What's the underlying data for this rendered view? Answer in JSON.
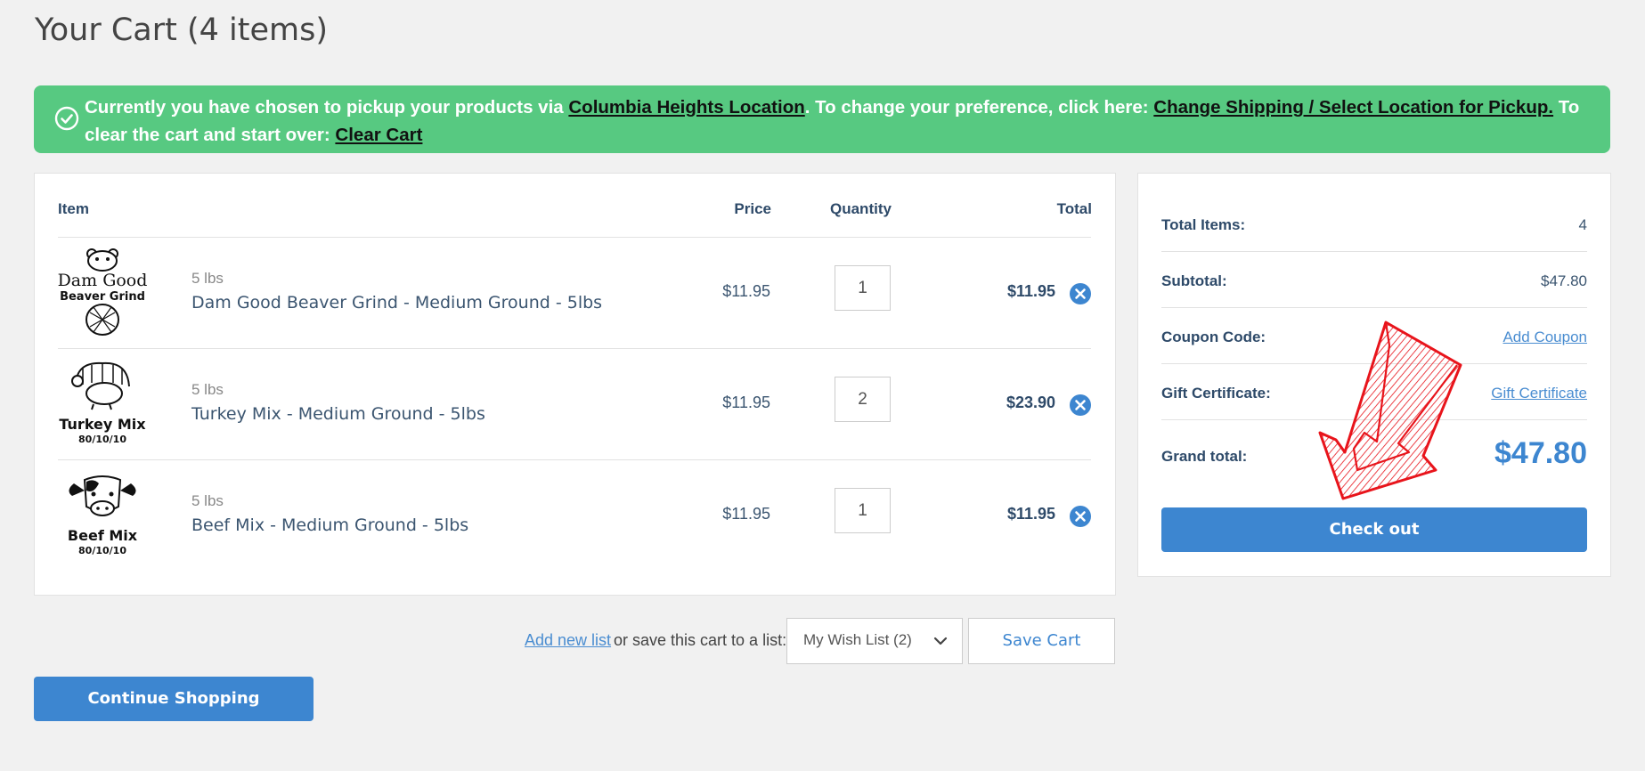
{
  "page": {
    "title": "Your Cart (4 items)"
  },
  "banner": {
    "text1": "Currently you have chosen to pickup your products via ",
    "location_link": "Columbia Heights Location",
    "text2": ". To change your preference, click here:  ",
    "change_link": "Change Shipping / Select Location for Pickup.",
    "text3": " To clear the cart and start over: ",
    "clear_link": "Clear Cart"
  },
  "cart": {
    "headers": {
      "item": "Item",
      "price": "Price",
      "quantity": "Quantity",
      "total": "Total"
    },
    "items": [
      {
        "logo_text": [
          "Dam Good",
          "Beaver Grind"
        ],
        "unit": "5 lbs",
        "name": "Dam Good Beaver Grind - Medium Ground - 5lbs",
        "price": "$11.95",
        "qty": "1",
        "total": "$11.95"
      },
      {
        "logo_text": [
          "Turkey Mix",
          "80/10/10"
        ],
        "unit": "5 lbs",
        "name": "Turkey Mix - Medium Ground - 5lbs",
        "price": "$11.95",
        "qty": "2",
        "total": "$23.90"
      },
      {
        "logo_text": [
          "Beef Mix",
          "80/10/10"
        ],
        "unit": "5 lbs",
        "name": "Beef Mix - Medium Ground - 5lbs",
        "price": "$11.95",
        "qty": "1",
        "total": "$11.95"
      }
    ]
  },
  "summary": {
    "total_items_label": "Total Items:",
    "total_items_value": "4",
    "subtotal_label": "Subtotal:",
    "subtotal_value": "$47.80",
    "coupon_label": "Coupon Code:",
    "coupon_link": "Add Coupon",
    "gift_label": "Gift Certificate:",
    "gift_link": "Gift Certificate",
    "grand_label": "Grand total:",
    "grand_value": "$47.80",
    "checkout_label": "Check out"
  },
  "save": {
    "add_list": "Add new list",
    "or_text": "or save this cart to a list:",
    "wishlist_selected": "My Wish List (2)",
    "save_button": "Save Cart"
  },
  "continue_button": "Continue Shopping",
  "colors": {
    "banner": "#57c981",
    "accent": "#3d86d0",
    "arrow": "#e8141b"
  },
  "icons": {
    "banner": "check-circle-icon",
    "remove": "close-circle-icon",
    "select": "chevron-down-icon"
  }
}
